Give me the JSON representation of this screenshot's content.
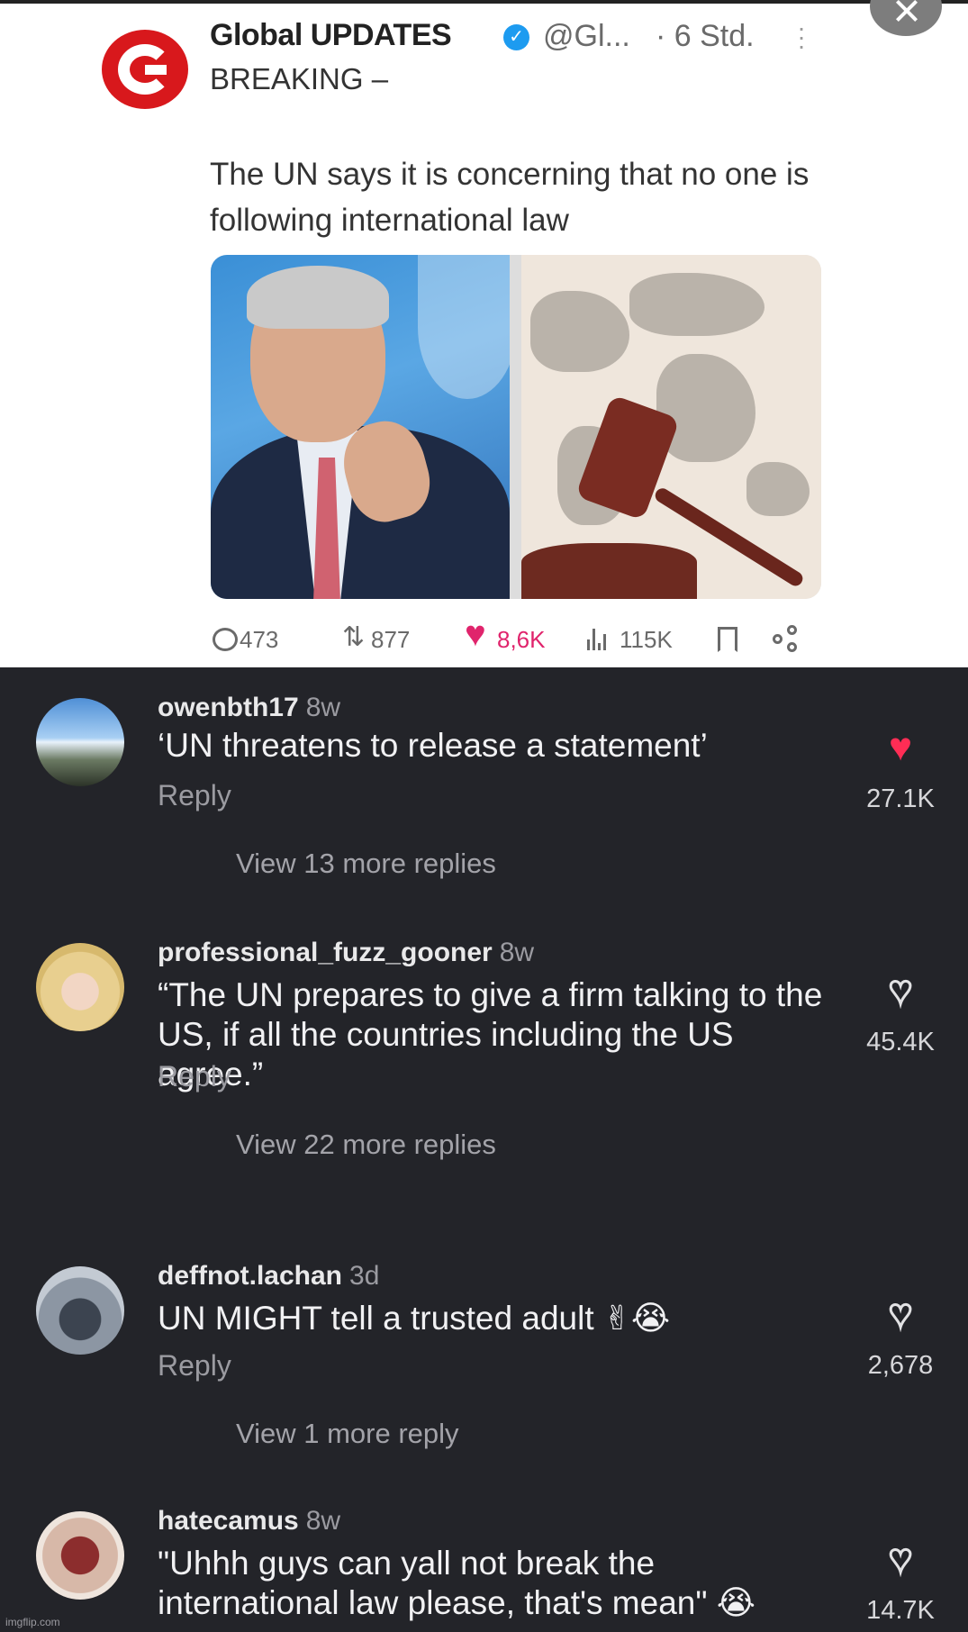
{
  "tweet": {
    "author_name": "Global UPDATES",
    "verified_icon": "verified-badge-icon",
    "handle": "@Gl...",
    "time": "· 6 Std.",
    "kicker": "BREAKING –",
    "body": "The UN says it is concerning that no one is following international law",
    "stats": {
      "replies": "473",
      "retweets": "877",
      "likes": "8,6K",
      "views": "115K"
    },
    "colors": {
      "like": "#e0246c",
      "avatar": "#d8181c",
      "verified": "#1d9bf0"
    }
  },
  "comments": [
    {
      "username": "owenbth17",
      "ago": "8w",
      "text": "‘UN threatens to release a statement’",
      "reply_label": "Reply",
      "more_label": "View 13 more replies",
      "likes": "27.1K",
      "liked": true
    },
    {
      "username": "professional_fuzz_gooner",
      "ago": "8w",
      "text": "“The UN prepares to give a firm talking to the US, if all the countries including the US agree.”",
      "reply_label": "Reply",
      "more_label": "View 22 more replies",
      "likes": "45.4K",
      "liked": false
    },
    {
      "username": "deffnot.lachan",
      "ago": "3d",
      "text": "UN MIGHT tell a trusted adult",
      "emojis": "✌😭",
      "reply_label": "Reply",
      "more_label": "View 1 more reply",
      "likes": "2,678",
      "liked": false
    },
    {
      "username": "hatecamus",
      "ago": "8w",
      "text": "\"Uhhh guys can yall not break the international law please, that's mean\"",
      "emojis": "😭",
      "likes": "14.7K",
      "liked": false
    }
  ],
  "colors": {
    "comment_bg": "#232429",
    "liked_heart": "#ff2d55"
  },
  "watermark": "imgflip.com"
}
